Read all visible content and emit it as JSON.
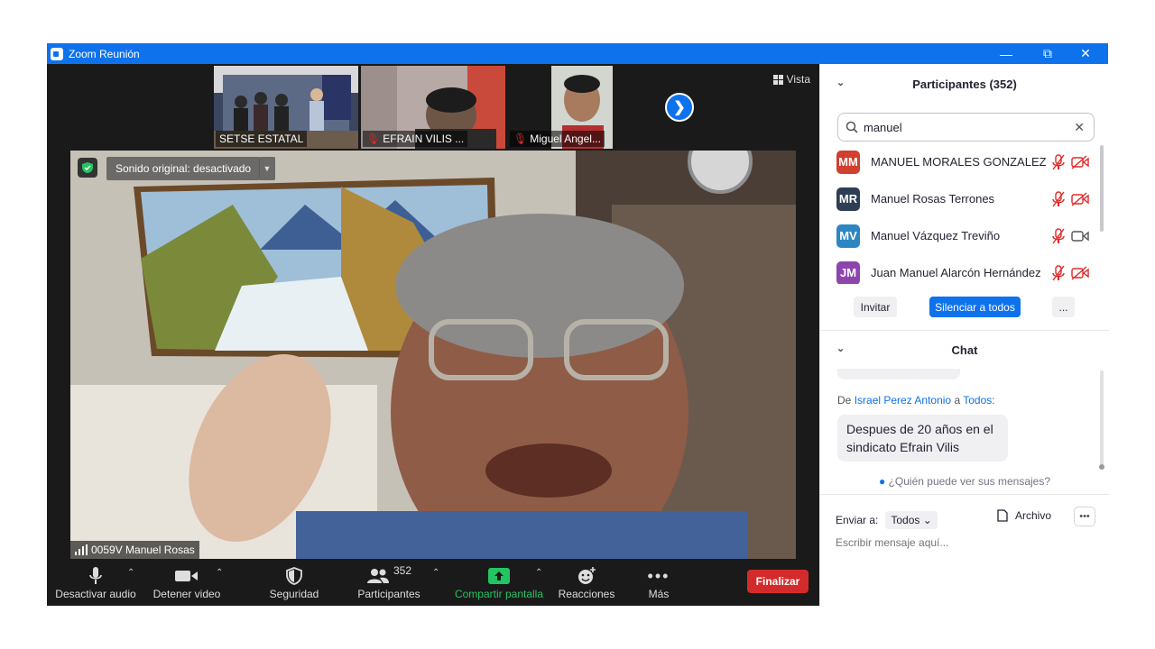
{
  "window": {
    "title": "Zoom Reunión"
  },
  "thumbnails": [
    {
      "name": "SETSE ESTATAL",
      "muted": false
    },
    {
      "name": "EFRAIN VILIS ...",
      "muted": true
    },
    {
      "name": "Miguel Angel...",
      "muted": true
    }
  ],
  "view": {
    "label": "Vista"
  },
  "main_video": {
    "sound_label": "Sonido original: desactivado",
    "speaker_name": "0059V Manuel Rosas"
  },
  "toolbar": {
    "audio_label": "Desactivar audio",
    "video_label": "Detener video",
    "security_label": "Seguridad",
    "participants_label": "Participantes",
    "participants_count": "352",
    "share_label": "Compartir pantalla",
    "reactions_label": "Reacciones",
    "more_label": "Más",
    "end_label": "Finalizar"
  },
  "participants": {
    "title": "Participantes (352)",
    "search_value": "manuel",
    "items": [
      {
        "initials": "MM",
        "name": "MANUEL MORALES GONZALEZ",
        "color": "#d13f2f",
        "video_off": true
      },
      {
        "initials": "MR",
        "name": "Manuel Rosas Terrones",
        "color": "#2d3e55",
        "video_off": true
      },
      {
        "initials": "MV",
        "name": "Manuel Vázquez Treviño",
        "color": "#2e86c1",
        "video_off": false
      },
      {
        "initials": "JM",
        "name": "Juan Manuel Alarcón Hernández",
        "color": "#8e44ad",
        "video_off": true
      }
    ],
    "invite_label": "Invitar",
    "mute_all_label": "Silenciar a todos",
    "more_label": "..."
  },
  "chat": {
    "title": "Chat",
    "from_prefix": "De",
    "from_name": "Israel Perez Antonio",
    "to_word": "a",
    "to_name": "Todos",
    "to_suffix": ":",
    "message": "Despues de 20 años en el sindicato Efrain Vilis",
    "who_sees": "¿Quién puede ver sus mensajes?",
    "send_to_label": "Enviar a:",
    "send_to_value": "Todos",
    "file_label": "Archivo",
    "input_placeholder": "Escribir mensaje aquí..."
  }
}
